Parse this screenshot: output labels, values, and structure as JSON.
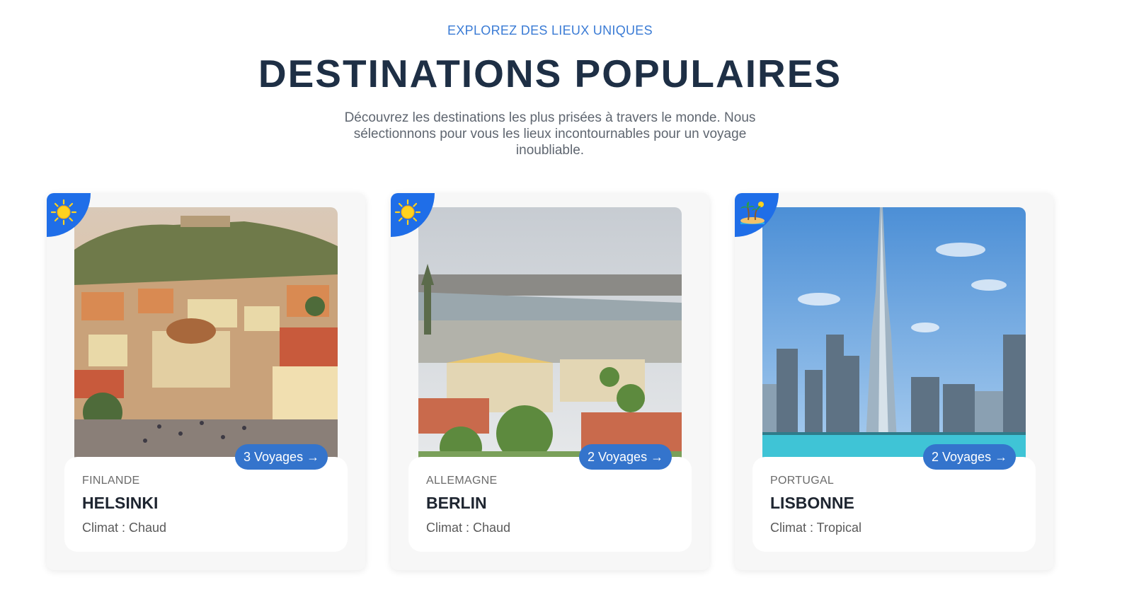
{
  "header": {
    "eyebrow": "EXPLOREZ DES LIEUX UNIQUES",
    "title": "DESTINATIONS POPULAIRES",
    "subtitle": "Découvrez les destinations les plus prisées à travers le monde. Nous sélectionnons pour vous les lieux incontournables pour un voyage inoubliable."
  },
  "cards": [
    {
      "country": "FINLANDE",
      "city": "HELSINKI",
      "climate": "Climat : Chaud",
      "voyages": "3 Voyages →",
      "climate_icon": "sun-icon"
    },
    {
      "country": "ALLEMAGNE",
      "city": "BERLIN",
      "climate": "Climat : Chaud",
      "voyages": "2 Voyages →",
      "climate_icon": "sun-icon"
    },
    {
      "country": "PORTUGAL",
      "city": "LISBONNE",
      "climate": "Climat : Tropical",
      "voyages": "2 Voyages →",
      "climate_icon": "palm-island-icon"
    }
  ],
  "colors": {
    "accent": "#3474cc",
    "badge": "#1f6ee8",
    "title": "#1e2f45"
  }
}
